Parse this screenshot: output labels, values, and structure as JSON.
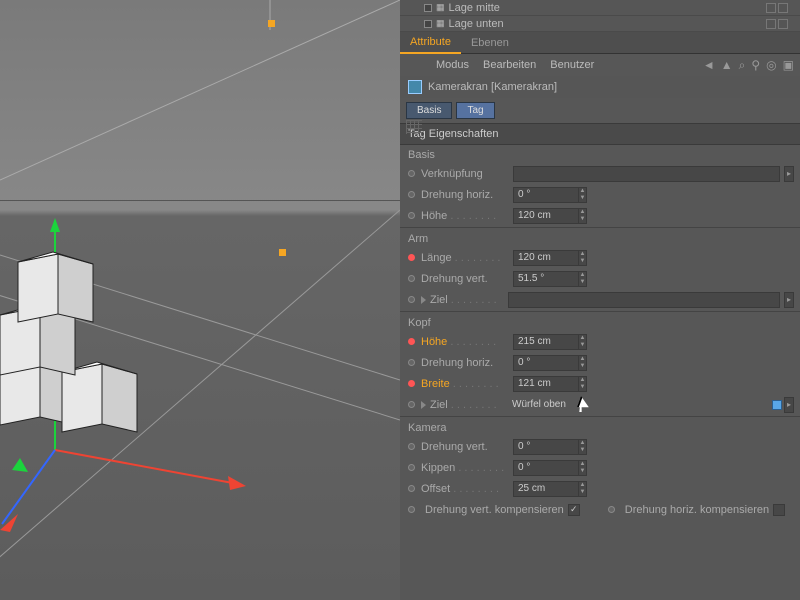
{
  "scene_tree": {
    "items": [
      {
        "label": "Lage mitte"
      },
      {
        "label": "Lage unten"
      }
    ]
  },
  "tabs": {
    "attribute": "Attribute",
    "ebenen": "Ebenen"
  },
  "menu": {
    "modus": "Modus",
    "bearbeiten": "Bearbeiten",
    "benutzer": "Benutzer"
  },
  "object": {
    "name": "Kamerakran [Kamerakran]"
  },
  "sub_tabs": {
    "basis": "Basis",
    "tag": "Tag"
  },
  "section": {
    "title": "Tag Eigenschaften"
  },
  "groups": {
    "basis": "Basis",
    "arm": "Arm",
    "kopf": "Kopf",
    "kamera": "Kamera"
  },
  "basis": {
    "verknuepfung_label": "Verknüpfung",
    "drehung_horiz_label": "Drehung horiz.",
    "drehung_horiz_val": "0 °",
    "hoehe_label": "Höhe",
    "hoehe_val": "120 cm"
  },
  "arm": {
    "laenge_label": "Länge",
    "laenge_val": "120 cm",
    "drehung_vert_label": "Drehung vert.",
    "drehung_vert_val": "51.5 °",
    "ziel_label": "Ziel"
  },
  "kopf": {
    "hoehe_label": "Höhe",
    "hoehe_val": "215 cm",
    "drehung_horiz_label": "Drehung horiz.",
    "drehung_horiz_val": "0 °",
    "breite_label": "Breite",
    "breite_val": "121 cm",
    "ziel_label": "Ziel",
    "ziel_val": "Würfel oben"
  },
  "kamera": {
    "drehung_vert_label": "Drehung vert.",
    "drehung_vert_val": "0 °",
    "kippen_label": "Kippen",
    "kippen_val": "0 °",
    "offset_label": "Offset",
    "offset_val": "25 cm",
    "comp_vert_label": "Drehung vert. kompensieren",
    "comp_horiz_label": "Drehung horiz. kompensieren",
    "comp_vert_checked": "✓"
  }
}
